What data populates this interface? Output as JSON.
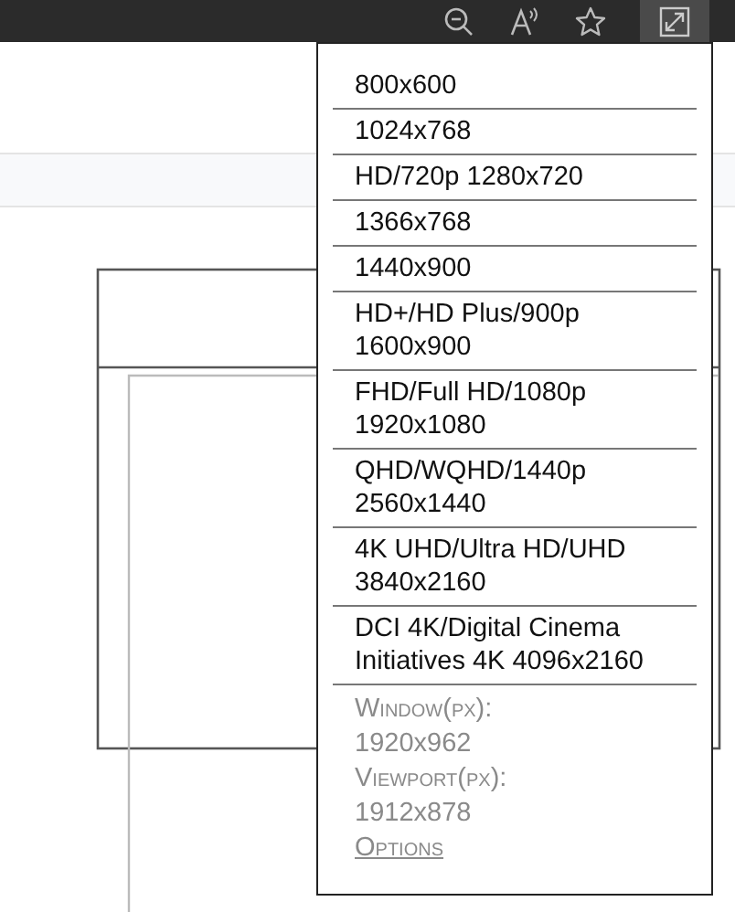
{
  "toolbar": {
    "resize_button": {
      "active": true
    }
  },
  "menu": {
    "resolutions": [
      {
        "label": "800x600"
      },
      {
        "label": "1024x768"
      },
      {
        "label": "HD/720p 1280x720"
      },
      {
        "label": "1366x768"
      },
      {
        "label": "1440x900"
      },
      {
        "label": "HD+/HD Plus/900p\n1600x900"
      },
      {
        "label": "FHD/Full HD/1080p\n1920x1080"
      },
      {
        "label": "QHD/WQHD/1440p\n2560x1440"
      },
      {
        "label": "4K UHD/Ultra HD/UHD\n3840x2160"
      },
      {
        "label": "DCI 4K/Digital Cinema\nInitiatives 4K 4096x2160"
      }
    ],
    "info": [
      {
        "kind": "label",
        "text": "Window(px):"
      },
      {
        "kind": "value",
        "text": "1920x962"
      },
      {
        "kind": "label",
        "text": "Viewport(px):"
      },
      {
        "kind": "value",
        "text": "1912x878"
      },
      {
        "kind": "link",
        "text": "Options"
      }
    ]
  }
}
